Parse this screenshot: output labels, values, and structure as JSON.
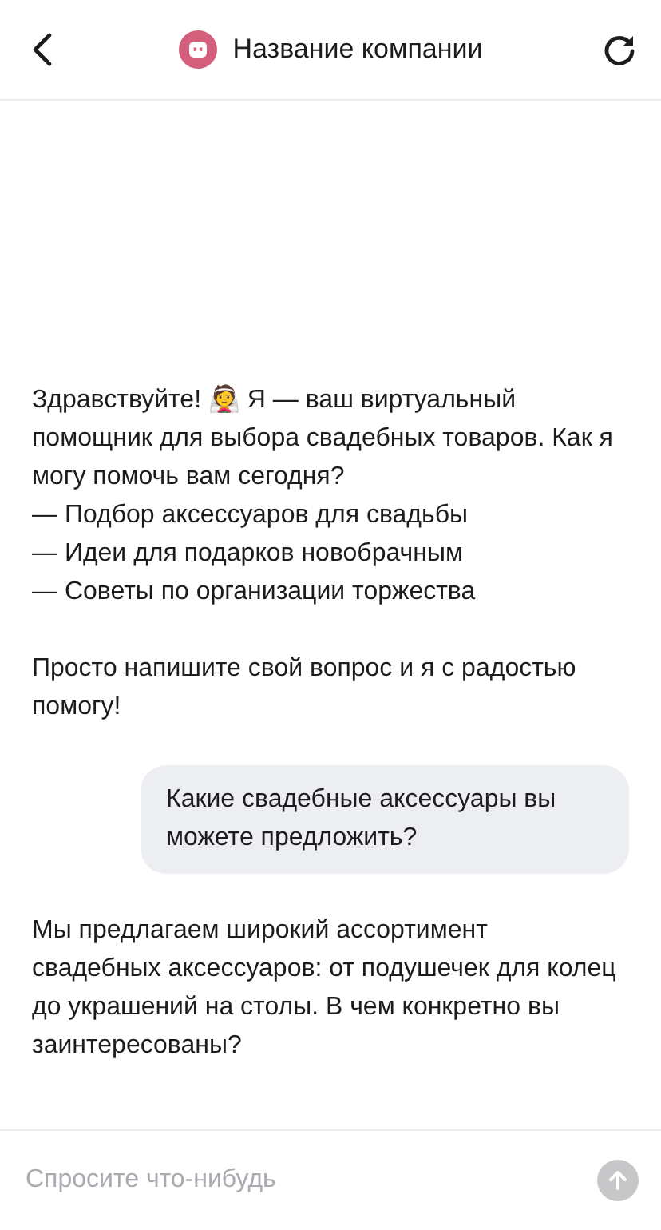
{
  "header": {
    "title": "Название компании"
  },
  "messages": [
    {
      "kind": "bot",
      "paragraphs": [
        [
          "Здравствуйте! 👰 Я — ваш виртуальный помощник для выбора свадебных товаров. Как я могу помочь вам сегодня?",
          "— Подбор аксессуаров для свадьбы",
          "— Идеи для подарков новобрачным",
          "— Советы по организации торжества"
        ],
        [
          "Просто напишите свой вопрос и я с радостью помогу!"
        ]
      ]
    },
    {
      "kind": "user",
      "paragraphs": [
        [
          "Какие свадебные аксессуары вы можете предложить?"
        ]
      ]
    },
    {
      "kind": "bot",
      "paragraphs": [
        [
          "Мы предлагаем широкий ассортимент свадебных аксессуаров: от подушечек для колец до украшений на столы. В чем конкретно вы заинтересованы?"
        ]
      ]
    }
  ],
  "composer": {
    "placeholder": "Спросите что-нибудь"
  }
}
